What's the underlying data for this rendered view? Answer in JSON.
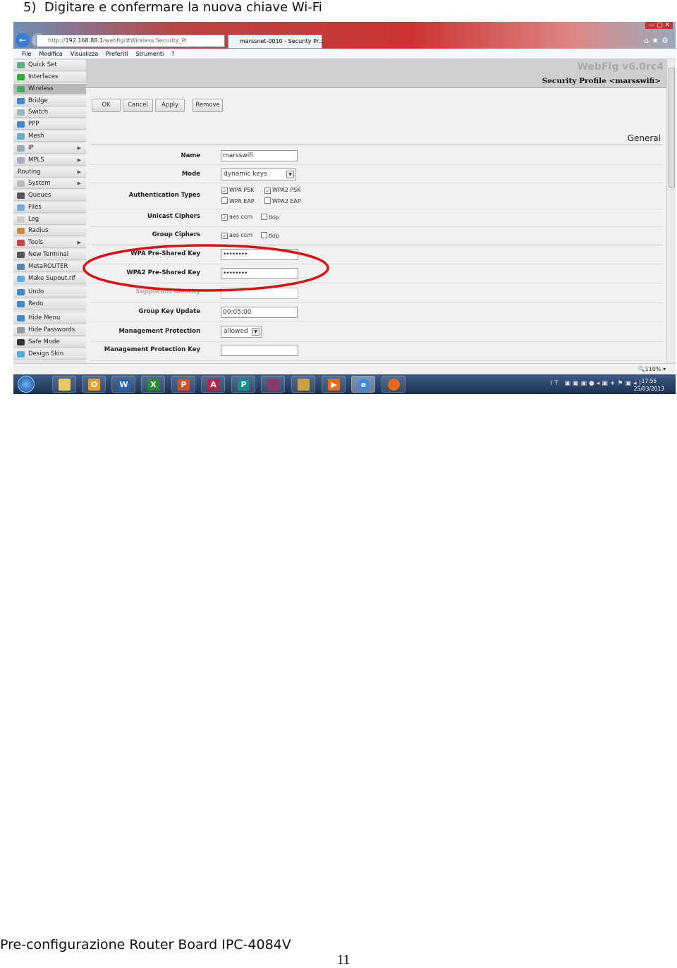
{
  "step_title": "5)  Digitare e confermare la nuova chiave Wi-Fi",
  "browser": {
    "url_prefix": "http://",
    "url_host": "192.168.88.1",
    "url_path": "/webfig/#Wireless.Security_Pr",
    "tab_title": "marssnet-0010 - Security Pr...",
    "menu": [
      "File",
      "Modifica",
      "Visualizza",
      "Preferiti",
      "Strumenti",
      "?"
    ],
    "zoom": "110%"
  },
  "sidebar": {
    "items": [
      {
        "label": "Quick Set",
        "icon": "quickset-icon",
        "color": "#6a8"
      },
      {
        "label": "Interfaces",
        "icon": "interfaces-icon",
        "color": "#3a3"
      },
      {
        "label": "Wireless",
        "icon": "wireless-icon",
        "color": "#4a6",
        "selected": true
      },
      {
        "label": "Bridge",
        "icon": "bridge-icon",
        "color": "#48c"
      },
      {
        "label": "Switch",
        "icon": "switch-icon",
        "color": "#9bb"
      },
      {
        "label": "PPP",
        "icon": "ppp-icon",
        "color": "#48c"
      },
      {
        "label": "Mesh",
        "icon": "mesh-icon",
        "color": "#6ac"
      },
      {
        "label": "IP",
        "icon": "ip-icon",
        "color": "#9ab",
        "submenu": true
      },
      {
        "label": "MPLS",
        "icon": "mpls-icon",
        "color": "#aab",
        "submenu": true
      },
      {
        "label": "Routing",
        "icon": "",
        "color": "",
        "submenu": true
      },
      {
        "label": "System",
        "icon": "system-icon",
        "color": "#bbb",
        "submenu": true
      },
      {
        "label": "Queues",
        "icon": "queues-icon",
        "color": "#555"
      },
      {
        "label": "Files",
        "icon": "files-icon",
        "color": "#7ad"
      },
      {
        "label": "Log",
        "icon": "log-icon",
        "color": "#ccc"
      },
      {
        "label": "Radius",
        "icon": "radius-icon",
        "color": "#c84"
      },
      {
        "label": "Tools",
        "icon": "tools-icon",
        "color": "#c44",
        "submenu": true
      },
      {
        "label": "New Terminal",
        "icon": "terminal-icon",
        "color": "#555"
      },
      {
        "label": "MetaROUTER",
        "icon": "metarouter-icon",
        "color": "#58a"
      },
      {
        "label": "Make Supout.rif",
        "icon": "supout-icon",
        "color": "#6ad"
      },
      {
        "label": "Undo",
        "icon": "undo-icon",
        "color": "#48c"
      },
      {
        "label": "Redo",
        "icon": "redo-icon",
        "color": "#48c"
      },
      {
        "label": "Hide Menu",
        "icon": "hide-menu-icon",
        "color": "#48c"
      },
      {
        "label": "Hide Passwords",
        "icon": "hide-passwords-icon",
        "color": "#999"
      },
      {
        "label": "Safe Mode",
        "icon": "safe-mode-icon",
        "color": "#333"
      },
      {
        "label": "Design Skin",
        "icon": "design-skin-icon",
        "color": "#5ad"
      }
    ]
  },
  "header": {
    "app_version": "WebFig v6.0rc4",
    "title": "Security Profile <marsswifi>"
  },
  "buttons": {
    "ok": "OK",
    "cancel": "Cancel",
    "apply": "Apply",
    "remove": "Remove"
  },
  "section": "General",
  "form": {
    "name": {
      "label": "Name",
      "value": "marsswifi"
    },
    "mode": {
      "label": "Mode",
      "value": "dynamic keys"
    },
    "auth": {
      "label": "Authentication Types",
      "options": [
        {
          "label": "WPA PSK",
          "checked": true
        },
        {
          "label": "WPA2 PSK",
          "checked": true
        },
        {
          "label": "WPA EAP",
          "checked": false
        },
        {
          "label": "WPA2 EAP",
          "checked": false
        }
      ]
    },
    "unicast": {
      "label": "Unicast Ciphers",
      "options": [
        {
          "label": "aes ccm",
          "checked": true
        },
        {
          "label": "tkip",
          "checked": false
        }
      ]
    },
    "group": {
      "label": "Group Ciphers",
      "options": [
        {
          "label": "aes ccm",
          "checked": true
        },
        {
          "label": "tkip",
          "checked": false
        }
      ]
    },
    "wpa_key": {
      "label": "WPA Pre-Shared Key",
      "value": "••••••••"
    },
    "wpa2_key": {
      "label": "WPA2 Pre-Shared Key",
      "value": "••••••••"
    },
    "supplicant": {
      "label": "Supplicant Identity",
      "value": ""
    },
    "group_key_update": {
      "label": "Group Key Update",
      "value": "00:05:00"
    },
    "mgmt_protection": {
      "label": "Management Protection",
      "value": "allowed"
    },
    "mgmt_key": {
      "label": "Management Protection Key",
      "value": ""
    }
  },
  "highlight_color": "#dd1111",
  "taskbar": {
    "apps": [
      {
        "name": "explorer",
        "glyph": "",
        "color": "#e8c860"
      },
      {
        "name": "outlook",
        "glyph": "O",
        "color": "#e8a020"
      },
      {
        "name": "word",
        "glyph": "W",
        "color": "#2b5fb0"
      },
      {
        "name": "excel",
        "glyph": "X",
        "color": "#2a8a3a"
      },
      {
        "name": "powerpoint",
        "glyph": "P",
        "color": "#d0502a"
      },
      {
        "name": "access",
        "glyph": "A",
        "color": "#b0284a"
      },
      {
        "name": "publisher",
        "glyph": "P",
        "color": "#1a8a8a"
      },
      {
        "name": "winrar",
        "glyph": "",
        "color": "#8a3a6a"
      },
      {
        "name": "app",
        "glyph": "",
        "color": "#c8a040"
      },
      {
        "name": "media-player",
        "glyph": "▶",
        "color": "#e07020"
      },
      {
        "name": "internet-explorer",
        "glyph": "e",
        "color": "#3a8ae0",
        "active": true
      },
      {
        "name": "firefox",
        "glyph": "",
        "color": "#e06a20"
      }
    ],
    "lang": "IT",
    "time": "17:55",
    "date": "25/03/2013"
  },
  "footer": "Pre-configurazione Router Board IPC-4084V",
  "page_number": "11"
}
